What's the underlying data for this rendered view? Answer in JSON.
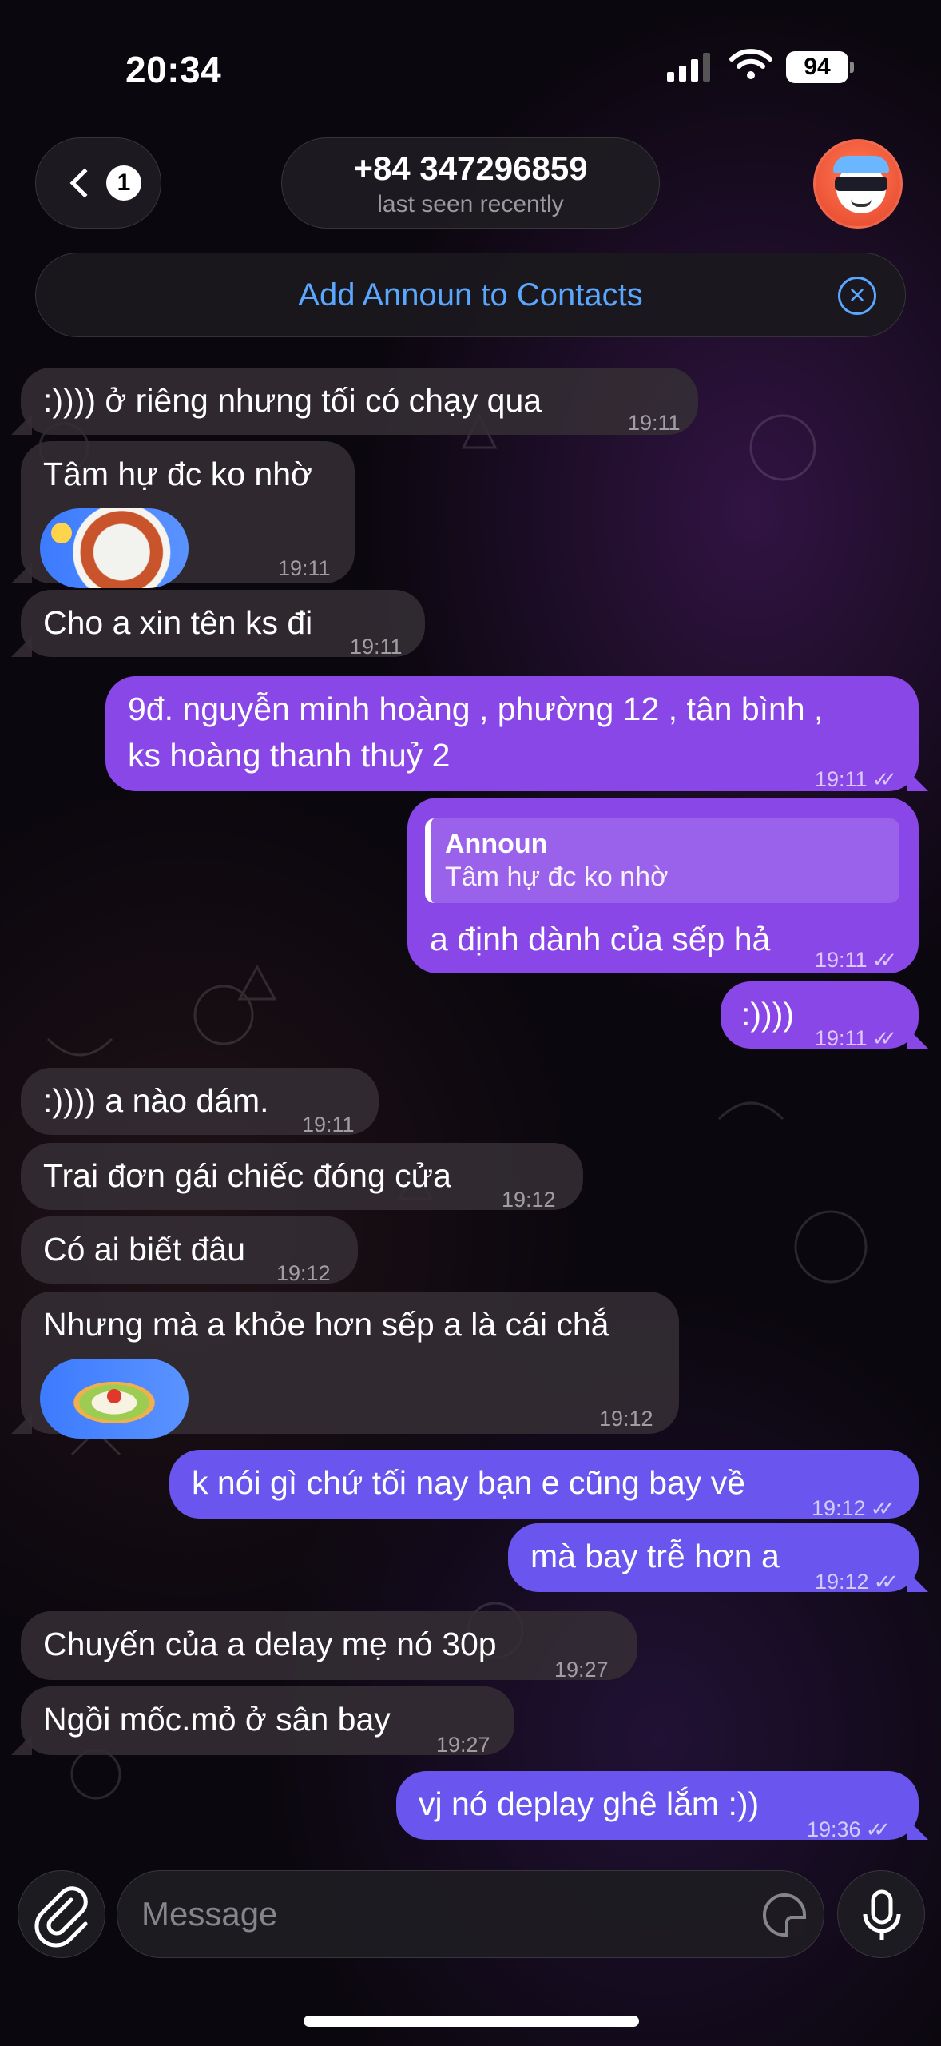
{
  "status_bar": {
    "time": "20:34",
    "battery": "94"
  },
  "header": {
    "back_badge": "1",
    "contact_name": "+84 347296859",
    "contact_status": "last seen recently",
    "add_contact_label": "Add Announ to Contacts"
  },
  "messages": [
    {
      "dir": "in",
      "text": ":)))) ở riêng nhưng tối có chạy qua",
      "time": "19:11"
    },
    {
      "dir": "in",
      "text": "Tâm hự đc ko nhờ",
      "time": "19:11",
      "sticker": "noodle-soup-sticker"
    },
    {
      "dir": "in",
      "text": "Cho a xin tên ks đi",
      "time": "19:11"
    },
    {
      "dir": "out",
      "text": "9đ. nguyễn minh hoàng , phường 12 , tân bình ,",
      "text2": "ks hoàng thanh thuỷ 2",
      "time": "19:11"
    },
    {
      "dir": "out",
      "reply_name": "Announ",
      "reply_text": "Tâm hự đc ko nhờ",
      "text": "a định dành của sếp hả",
      "time": "19:11"
    },
    {
      "dir": "out",
      "text": ":))))",
      "time": "19:11"
    },
    {
      "dir": "in",
      "text": ":)))) a nào dám.",
      "time": "19:11"
    },
    {
      "dir": "in",
      "text": "Trai đơn gái chiếc đóng cửa",
      "time": "19:12"
    },
    {
      "dir": "in",
      "text": "Có ai biết đâu",
      "time": "19:12"
    },
    {
      "dir": "in",
      "text": "Nhưng mà a khỏe hơn sếp a là cái chắ",
      "time": "19:12",
      "sticker": "food-platter-sticker"
    },
    {
      "dir": "out",
      "text": "k nói gì chứ tối nay bạn e cũng bay về",
      "time": "19:12"
    },
    {
      "dir": "out",
      "text": "mà bay trễ hơn a",
      "time": "19:12"
    },
    {
      "dir": "in",
      "text": "Chuyến của a delay mẹ nó 30p",
      "time": "19:27"
    },
    {
      "dir": "in",
      "text": "Ngồi mốc.mỏ ở sân bay",
      "time": "19:27"
    },
    {
      "dir": "out",
      "text": "vj nó deplay ghê lắm :))",
      "time": "19:36"
    }
  ],
  "composer": {
    "placeholder": "Message"
  },
  "colors": {
    "outgoing_purple": "#8a47e8",
    "outgoing_blue": "#6a55ef",
    "incoming": "#342e34",
    "link_blue": "#5aa7ff"
  },
  "icons": [
    "chevron-left-icon",
    "paperclip-icon",
    "sticker-icon",
    "microphone-icon",
    "close-circle-icon",
    "double-check-icon"
  ]
}
